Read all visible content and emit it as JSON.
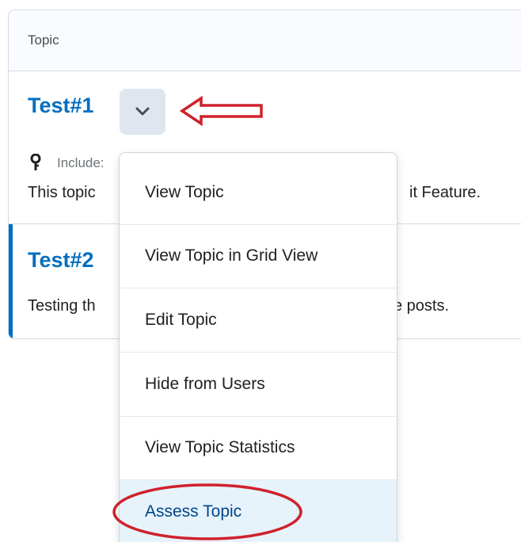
{
  "table": {
    "header_label": "Topic"
  },
  "topics": [
    {
      "title": "Test#1",
      "includes_text": "Include:",
      "description_left": "This topic",
      "description_right": "it Feature."
    },
    {
      "title": "Test#2",
      "description_left": "Testing th",
      "description_right": "e posts."
    }
  ],
  "context_menu": {
    "items": [
      {
        "label": "View Topic"
      },
      {
        "label": "View Topic in Grid View"
      },
      {
        "label": "Edit Topic"
      },
      {
        "label": "Hide from Users"
      },
      {
        "label": "View Topic Statistics"
      },
      {
        "label": "Assess Topic"
      }
    ],
    "highlighted_item": "Assess Topic"
  },
  "icons": {
    "context_button": "chevron-down-icon",
    "topic_meta": "key-icon",
    "annotation_arrow": "left-arrow-icon",
    "annotation_circle": "ellipse-highlight"
  },
  "colors": {
    "link": "#006fbf",
    "accent_bar": "#006fbf",
    "annotation": "#d0212c",
    "menu_highlight": "#e6f3fb"
  }
}
